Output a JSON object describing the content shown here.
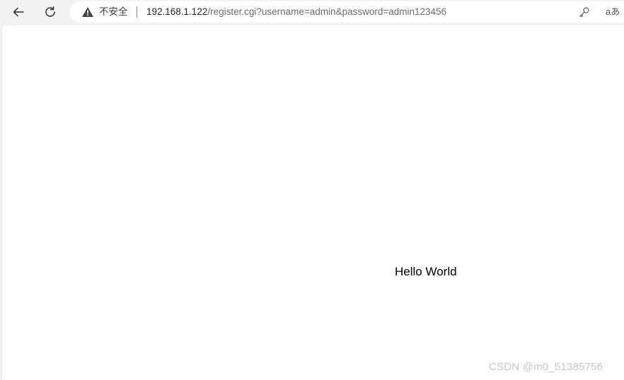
{
  "toolbar": {
    "back_icon": "back-arrow-icon",
    "reload_icon": "reload-icon"
  },
  "omnibox": {
    "security_icon": "warning-triangle-icon",
    "security_label": "不安全",
    "url_host": "192.168.1.122",
    "url_path": "/register.cgi?username=admin&password=admin123456",
    "key_icon": "key-icon",
    "translate_label": "aあ"
  },
  "page": {
    "body_text": "Hello World"
  },
  "watermark": {
    "text": "CSDN @m0_51385756"
  }
}
